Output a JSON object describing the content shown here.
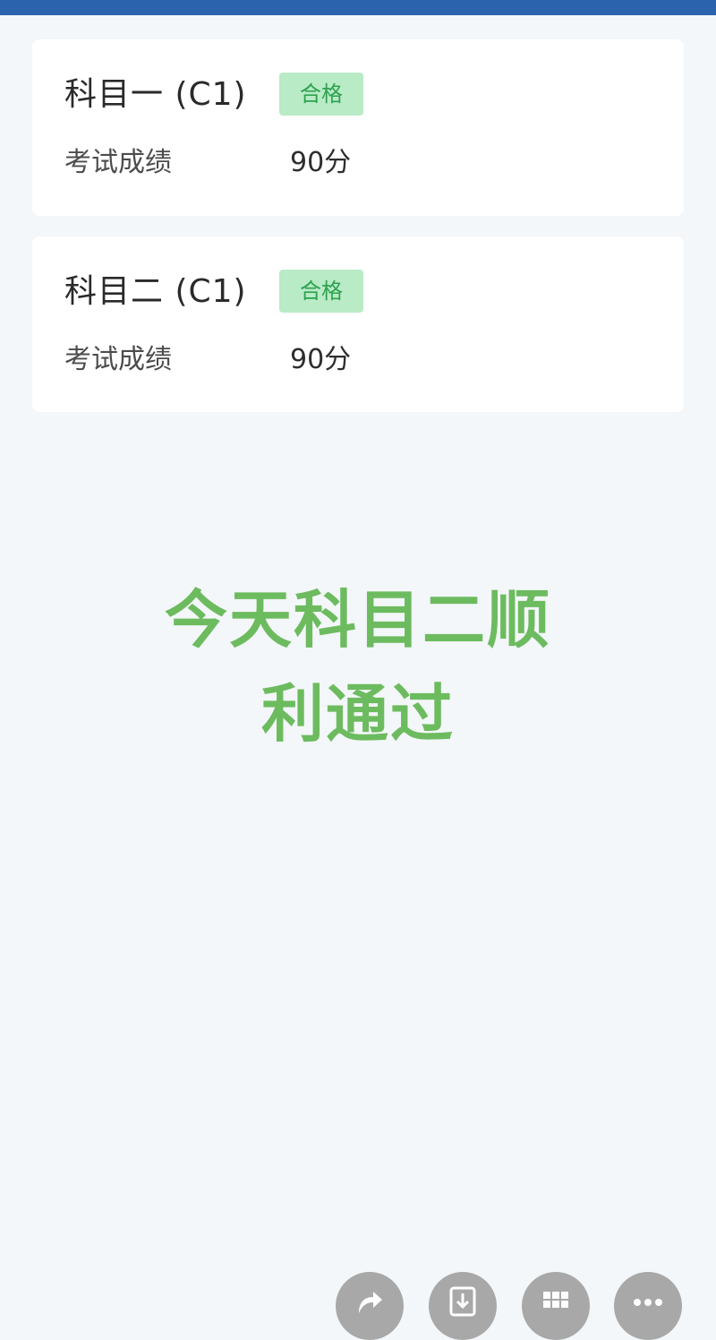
{
  "colors": {
    "top_bar": "#2b64ac",
    "page_background": "#f3f7f9",
    "badge_background": "#b8ebc6",
    "badge_text": "#2ea24f",
    "headline": "#6dbb5f"
  },
  "cards": [
    {
      "title": "科目一 (C1)",
      "status": "合格",
      "score_label": "考试成绩",
      "score_value": "90分"
    },
    {
      "title": "科目二 (C1)",
      "status": "合格",
      "score_label": "考试成绩",
      "score_value": "90分"
    }
  ],
  "headline": "今天科目二顺利通过",
  "action_buttons": [
    {
      "icon": "share-icon"
    },
    {
      "icon": "download-icon"
    },
    {
      "icon": "grid-icon"
    },
    {
      "icon": "more-icon"
    }
  ]
}
